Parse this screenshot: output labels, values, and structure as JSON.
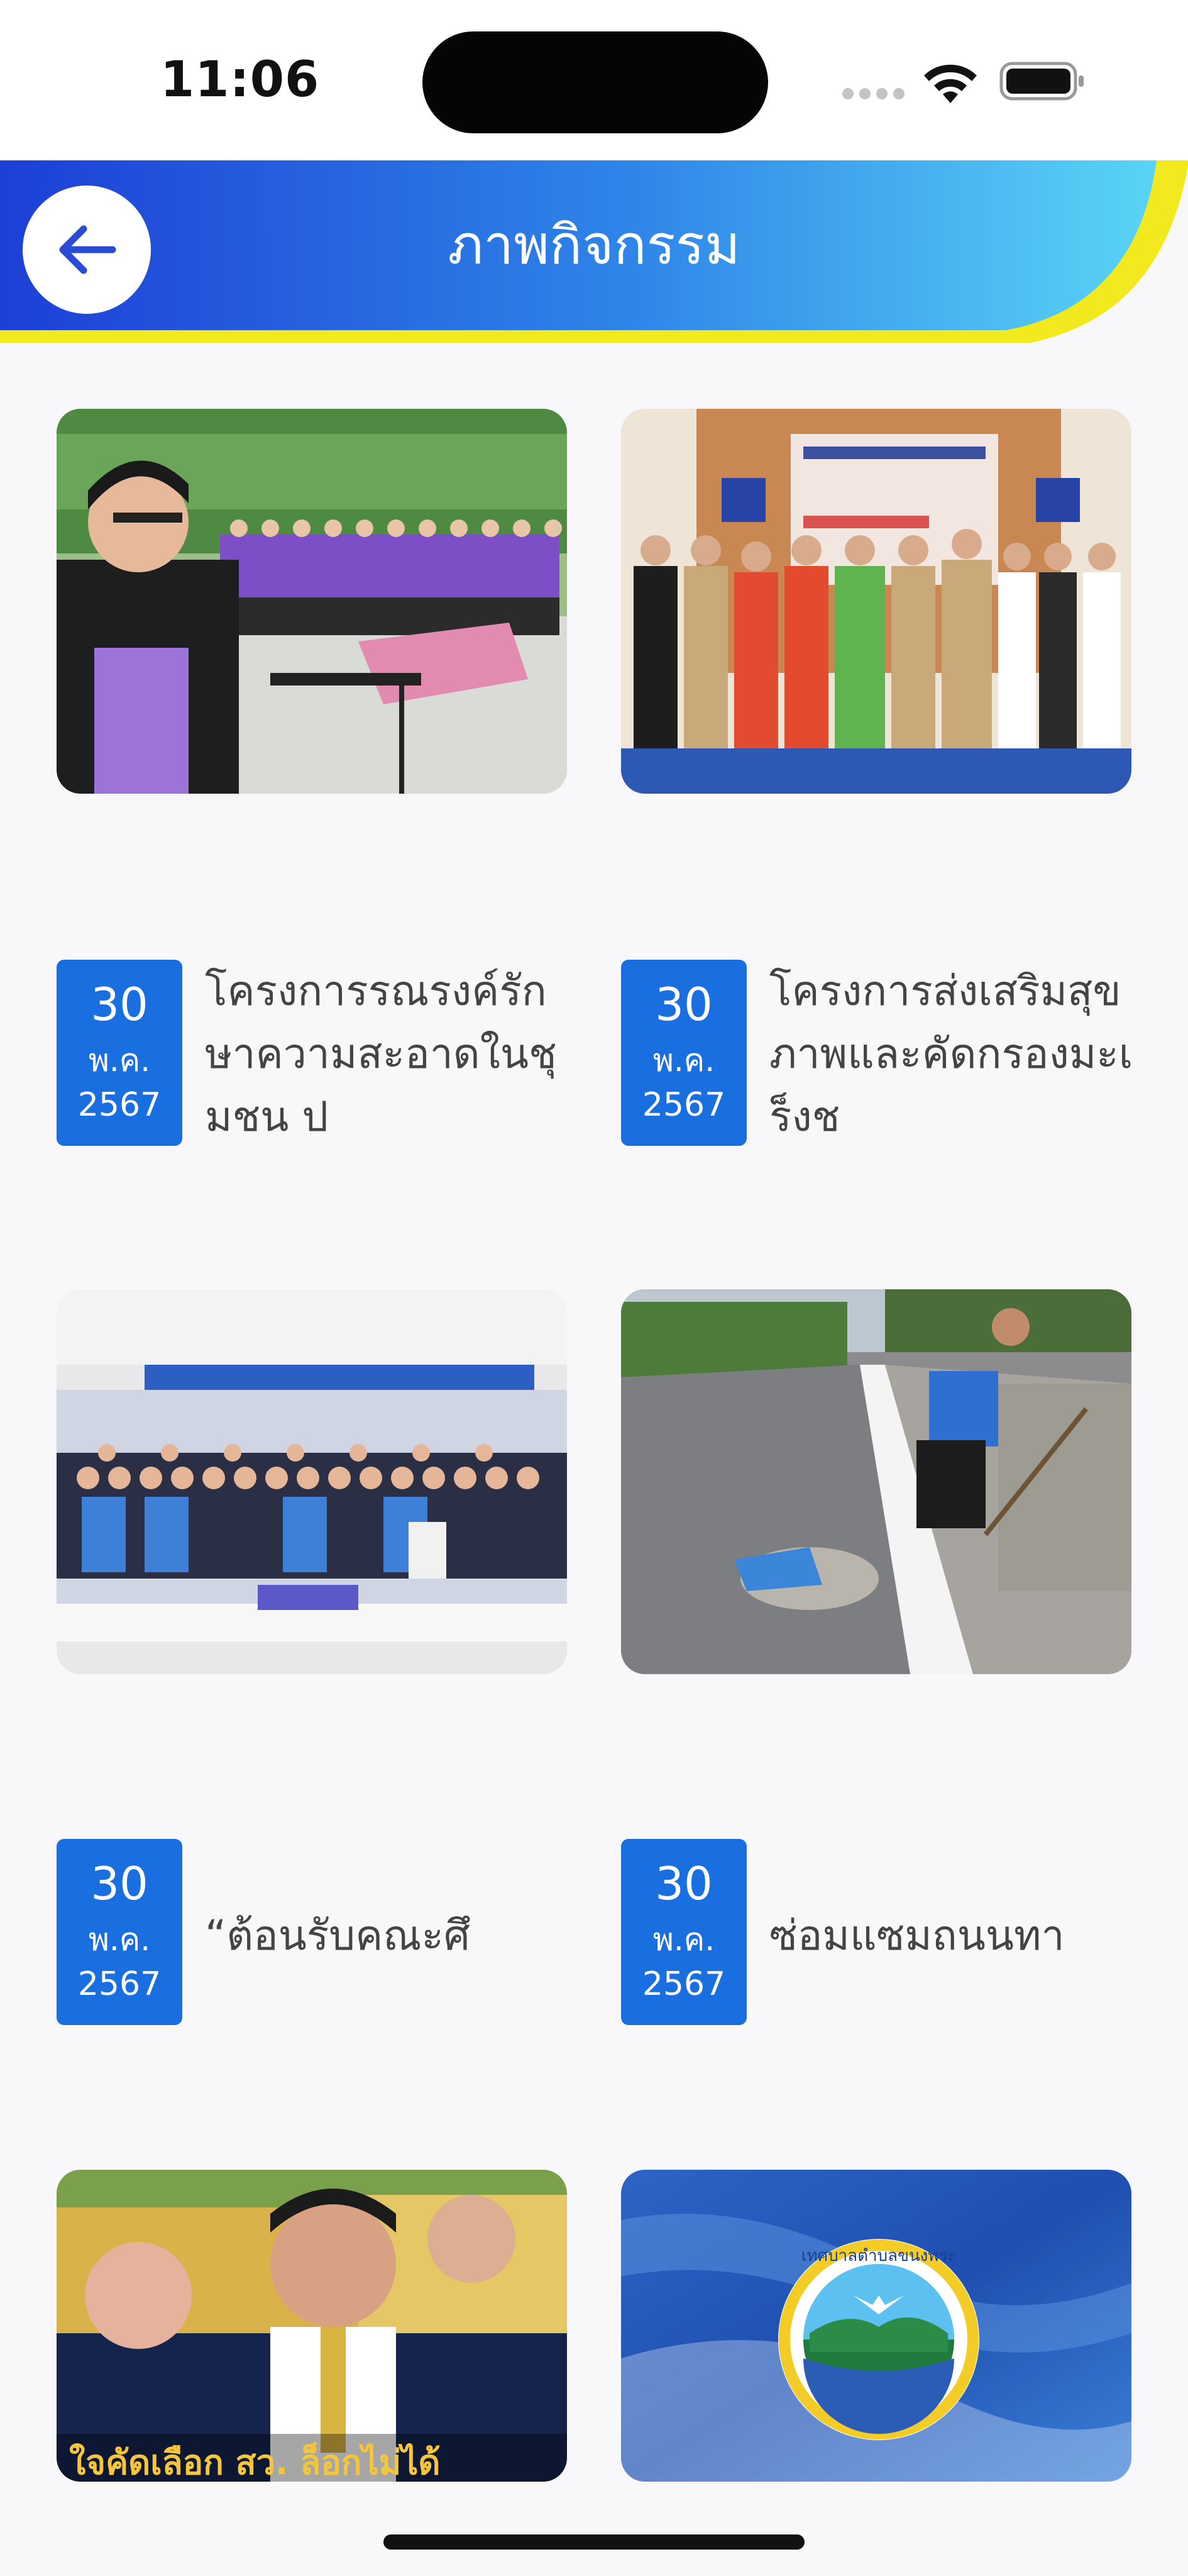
{
  "status_bar": {
    "time": "11:06"
  },
  "header": {
    "title": "ภาพกิจกรรม",
    "back_icon": "arrow-left-icon",
    "colors": {
      "gradient_start": "#1d3fd6",
      "gradient_end": "#5ad4f6",
      "accent_yellow": "#f2ea1f",
      "back_arrow": "#2a4bd6"
    }
  },
  "activities": [
    {
      "day": "30",
      "month": "พ.ค.",
      "year": "2567",
      "title": "โครงการรณรงค์รักษาความสะอาดในชุมชน ป",
      "image": "official-speaking-at-podium-with-staff-in-purple-shirts"
    },
    {
      "day": "30",
      "month": "พ.ค.",
      "year": "2567",
      "title": "โครงการส่งเสริมสุขภาพและคัดกรองมะเร็งช",
      "image": "group-photo-officials-in-front-of-banner"
    },
    {
      "day": "30",
      "month": "พ.ค.",
      "year": "2567",
      "title": "“ต้อนรับคณะศึ",
      "image": "large-group-photo-in-hall"
    },
    {
      "day": "30",
      "month": "พ.ค.",
      "year": "2567",
      "title": "ซ่อมแซมถนนทา",
      "image": "worker-repairing-road-pothole"
    },
    {
      "image": "officials-at-press-interview",
      "overlay_text": "ใจคัดเลือก สว. ล็อกไม่ได้"
    },
    {
      "image": "municipality-seal-on-blue-background",
      "seal_text": "เทศบาลตำบลขนงพระ"
    }
  ],
  "theme": {
    "badge_color": "#1a6fe0",
    "page_background": "#f8f7fa"
  }
}
